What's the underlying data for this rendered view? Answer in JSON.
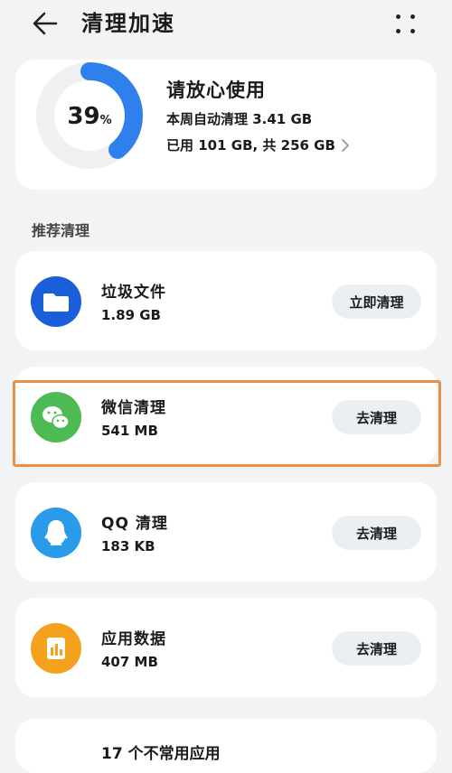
{
  "header": {
    "title": "清理加速"
  },
  "summary": {
    "percent": 39,
    "percent_value": "39",
    "percent_unit": "%",
    "status": "请放心使用",
    "auto_clean": "本周自动清理 3.41 GB",
    "storage": "已用 101 GB, 共 256 GB",
    "ring_color": "#2f80ed",
    "ring_track_color": "#eef0f2"
  },
  "section_label": "推荐清理",
  "items": [
    {
      "name": "垃圾文件",
      "size": "1.89 GB",
      "button": "立即清理",
      "icon": "folder-icon",
      "color": "#1a5fd9"
    },
    {
      "name": "微信清理",
      "size": "541 MB",
      "button": "去清理",
      "icon": "wechat-icon",
      "color": "#4cbb53"
    },
    {
      "name": "QQ 清理",
      "size": "183 KB",
      "button": "去清理",
      "icon": "qq-icon",
      "color": "#2a9be8"
    },
    {
      "name": "应用数据",
      "size": "407 MB",
      "button": "去清理",
      "icon": "app-data-icon",
      "color": "#f4a21e"
    }
  ],
  "partial_item": {
    "name": "17 个不常用应用"
  },
  "highlight_color": "#e8914a"
}
